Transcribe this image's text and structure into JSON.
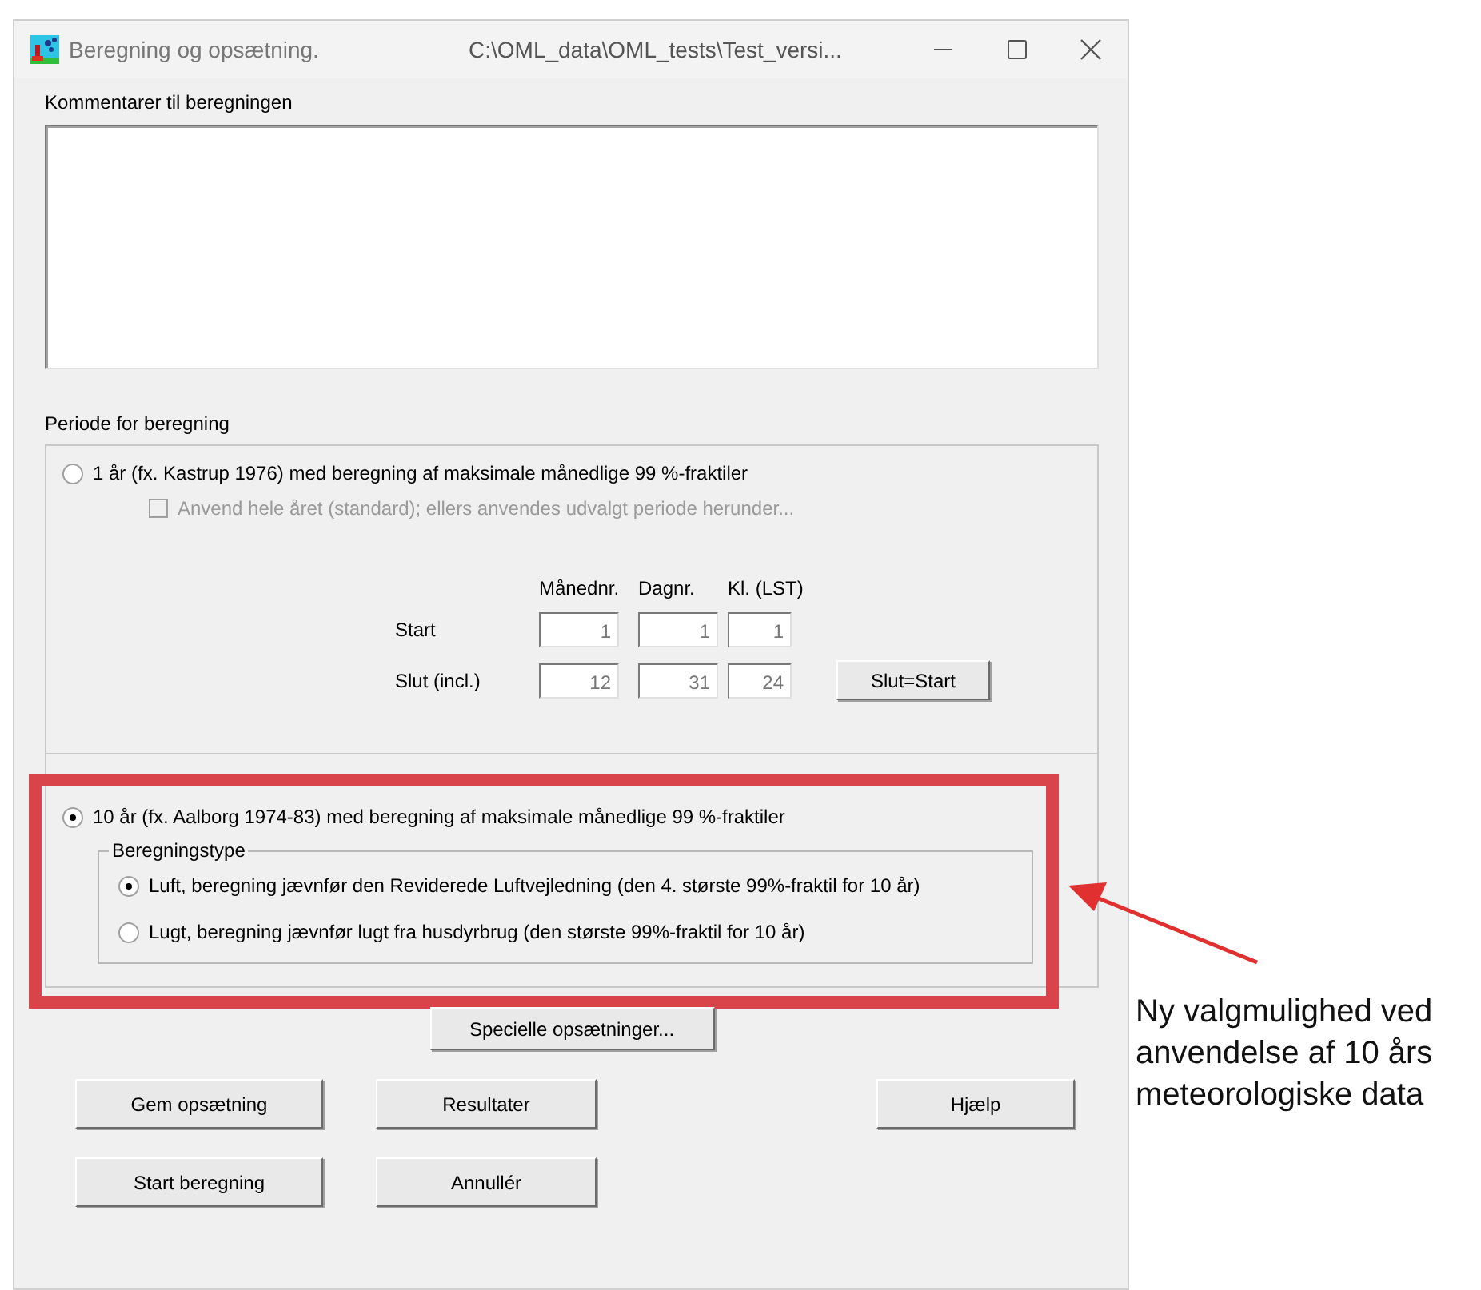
{
  "window": {
    "title": "Beregning og opsætning.",
    "path": "C:\\OML_data\\OML_tests\\Test_versi..."
  },
  "comments": {
    "label": "Kommentarer til beregningen"
  },
  "period": {
    "label": "Periode for beregning",
    "one_year": {
      "label": "1 år (fx. Kastrup 1976) med beregning af maksimale månedlige 99 %-fraktiler",
      "selected": false,
      "whole_year": {
        "label": "Anvend hele året (standard); ellers anvendes udvalgt periode herunder...",
        "checked": false,
        "disabled": true
      },
      "columns": [
        "Månednr.",
        "Dagnr.",
        "Kl. (LST)"
      ],
      "rows": [
        {
          "label": "Start",
          "values": [
            "1",
            "1",
            "1"
          ]
        },
        {
          "label": "Slut (incl.)",
          "values": [
            "12",
            "31",
            "24"
          ]
        }
      ],
      "button": "Slut=Start"
    },
    "ten_years": {
      "label": "10 år (fx. Aalborg 1974-83) med beregning af maksimale månedlige 99 %-fraktiler",
      "selected": true,
      "group": {
        "label": "Beregningstype",
        "options": [
          {
            "label": "Luft, beregning jævnfør den Reviderede Luftvejledning (den 4. største 99%-fraktil for 10 år)",
            "selected": true
          },
          {
            "label": "Lugt, beregning jævnfør lugt fra husdyrbrug (den største 99%-fraktil for 10 år)",
            "selected": false
          }
        ]
      }
    }
  },
  "special_button": "Specielle opsætninger...",
  "buttons": {
    "save": "Gem opsætning",
    "results": "Resultater",
    "help": "Hjælp",
    "start": "Start beregning",
    "cancel": "Annullér"
  },
  "annotation": "Ny valgmulighed ved anvendelse af 10 års meteorologiske data"
}
